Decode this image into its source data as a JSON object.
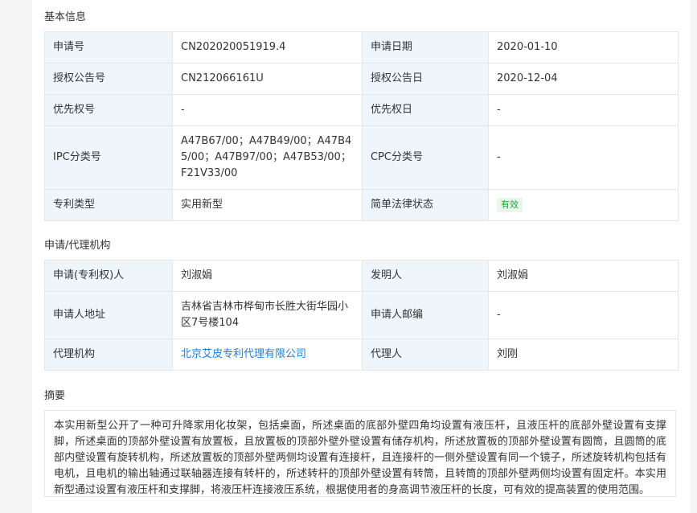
{
  "basic": {
    "title": "基本信息",
    "rows": [
      {
        "l1": "申请号",
        "v1": "CN202020051919.4",
        "l2": "申请日期",
        "v2": "2020-01-10"
      },
      {
        "l1": "授权公告号",
        "v1": "CN212066161U",
        "l2": "授权公告日",
        "v2": "2020-12-04"
      },
      {
        "l1": "优先权号",
        "v1": "-",
        "l2": "优先权日",
        "v2": "-"
      },
      {
        "l1": "IPC分类号",
        "v1": "A47B67/00；A47B49/00；A47B45/00；A47B97/00；A47B53/00；F21V33/00",
        "l2": "CPC分类号",
        "v2": "-"
      },
      {
        "l1": "专利类型",
        "v1": "实用新型",
        "l2": "简单法律状态",
        "v2": "有效"
      }
    ]
  },
  "agency": {
    "title": "申请/代理机构",
    "rows": [
      {
        "l1": "申请(专利权)人",
        "v1": "刘淑娟",
        "l2": "发明人",
        "v2": "刘淑娟"
      },
      {
        "l1": "申请人地址",
        "v1": "吉林省吉林市桦甸市长胜大街华园小区7号楼104",
        "l2": "申请人邮编",
        "v2": "-"
      },
      {
        "l1": "代理机构",
        "v1": "北京艾皮专利代理有限公司",
        "l2": "代理人",
        "v2": "刘刚"
      }
    ]
  },
  "abstract": {
    "title": "摘要",
    "text": "本实用新型公开了一种可升降家用化妆架，包括桌面，所述桌面的底部外壁四角均设置有液压杆，且液压杆的底部外壁设置有支撑脚，所述桌面的顶部外壁设置有放置板，且放置板的顶部外壁外壁设置有储存机构，所述放置板的顶部外壁设置有圆筒，且圆筒的底部内壁设置有旋转机构，所述放置板的顶部外壁两侧均设置有连接杆，且连接杆的一侧外壁设置有同一个镜子，所述旋转机构包括有电机，且电机的输出轴通过联轴器连接有转杆的，所述转杆的顶部外壁设置有转筒，且转筒的顶部外壁两侧均设置有固定杆。本实用新型通过设置有液压杆和支撑脚，将液压杆连接液压系统，根据使用者的身高调节液压杆的长度，可有效的提高装置的使用范围。"
  },
  "colors": {
    "label_bg": "#eef6fc",
    "badge_green": "#25a244",
    "link_blue": "#1f7fd4"
  }
}
